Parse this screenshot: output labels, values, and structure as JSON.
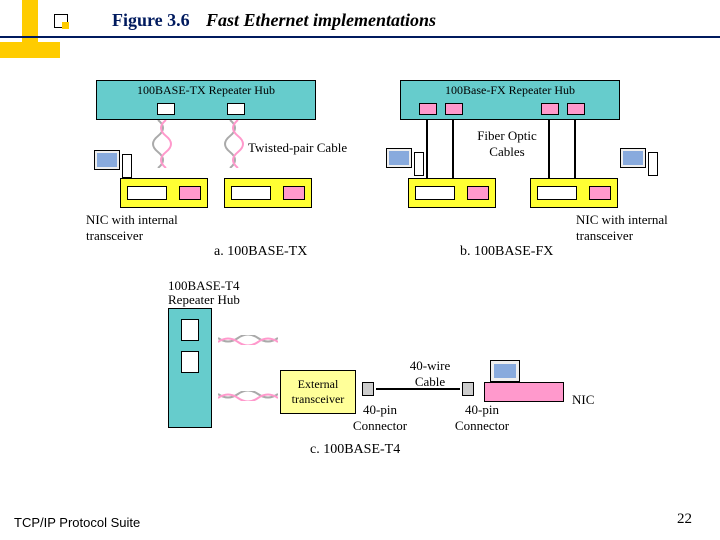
{
  "figure_number": "Figure 3.6",
  "figure_title": "Fast Ethernet implementations",
  "footer_left": "TCP/IP Protocol Suite",
  "page_number": "22",
  "hubs": {
    "a": "100BASE-TX  Repeater Hub",
    "b": "100Base-FX  Repeater Hub",
    "c_label_l1": "100BASE-T4",
    "c_label_l2": "Repeater Hub"
  },
  "labels": {
    "twisted": "Twisted-pair Cable",
    "fiber": "Fiber Optic Cables",
    "nic_internal_a": "NIC with internal transceiver",
    "nic_internal_b": "NIC with internal transceiver",
    "ext_trans_l1": "External",
    "ext_trans_l2": "transceiver",
    "conn40_1": "40-pin Connector",
    "conn40_2": "40-pin Connector",
    "wire40": "40-wire Cable",
    "nic_c": "NIC"
  },
  "captions": {
    "a": "a. 100BASE-TX",
    "b": "b. 100BASE-FX",
    "c": "c. 100BASE-T4"
  }
}
